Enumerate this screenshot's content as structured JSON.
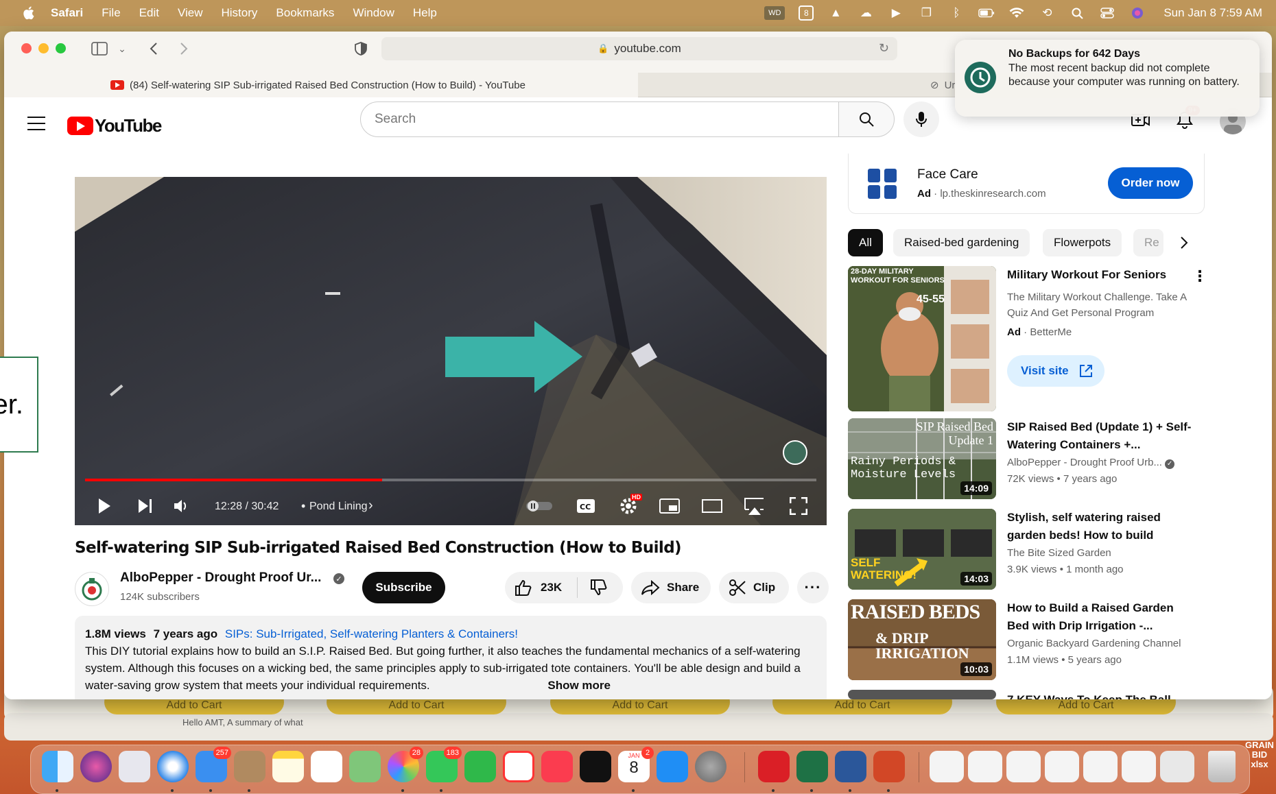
{
  "menubar": {
    "app": "Safari",
    "items": [
      "File",
      "Edit",
      "View",
      "History",
      "Bookmarks",
      "Window",
      "Help"
    ],
    "clock": "Sun Jan 8  7:59 AM"
  },
  "browser": {
    "url": "youtube.com",
    "active_tab": "(84) Self-watering SIP Sub-irrigated Raised Bed Construction (How to Build) - YouTube",
    "second_tab": "Ur"
  },
  "notification": {
    "title": "No Backups for 642 Days",
    "body": "The most recent backup did not complete because your computer was running on battery."
  },
  "youtube": {
    "logo": "YouTube",
    "search_placeholder": "Search",
    "notif_count": "9+"
  },
  "player": {
    "time": "12:28 / 30:42",
    "chapter": "Pond Lining",
    "progress": 0.406,
    "hd_badge": "HD"
  },
  "video": {
    "title": "Self-watering SIP Sub-irrigated Raised Bed Construction (How to Build)",
    "channel": "AlboPepper - Drought Proof Ur...",
    "subscribers": "124K subscribers",
    "subscribe_label": "Subscribe",
    "likes": "23K",
    "share_label": "Share",
    "clip_label": "Clip",
    "views": "1.8M views",
    "age": "7 years ago",
    "playlist": "SIPs: Sub-Irrigated, Self-watering Planters & Containers!",
    "description": "This DIY tutorial explains how to build an S.I.P. Raised Bed. But going further, it also teaches the fundamental mechanics of a self-watering system. Although this focuses on a wicking bed, the same principles apply to sub-irrigated tote containers. You'll be able design and build a water-saving grow system that meets your individual requirements.",
    "show_more": "Show more"
  },
  "ad": {
    "title": "Face Care",
    "label": "Ad",
    "domain": "lp.theskinresearch.com",
    "cta": "Order now"
  },
  "chips": [
    "All",
    "Raised-bed gardening",
    "Flowerpots",
    "Re"
  ],
  "recommendations": [
    {
      "title": "Military Workout For Seniors",
      "channel": "The Military Workout Challenge. Take A Quiz And Get Personal Program",
      "meta": "BetterMe",
      "ad_label": "Ad",
      "cta": "Visit site",
      "thumb_text": "28-DAY MILITARY WORKOUT FOR SENIORS",
      "thumb_num": "45-55"
    },
    {
      "title": "SIP Raised Bed (Update 1) + Self-Watering Containers +...",
      "channel": "AlboPepper - Drought Proof Urb...",
      "meta": "72K views  • 7 years ago",
      "duration": "14:09",
      "thumb_text": "SIP Raised Bed Update 1",
      "thumb_text2": "Rainy Periods & Moisture Levels"
    },
    {
      "title": "Stylish, self watering raised garden beds! How to build",
      "channel": "The Bite Sized Garden",
      "meta": "3.9K views  • 1 month ago",
      "duration": "14:03",
      "thumb_text": "SELF WATERING!"
    },
    {
      "title": "How to Build a Raised Garden Bed with Drip Irrigation -...",
      "channel": "Organic Backyard Gardening Channel",
      "meta": "1.1M views  • 5 years ago",
      "duration": "10:03",
      "thumb_text": "RAISED BEDS",
      "thumb_text2": "& DRIP IRRIGATION"
    },
    {
      "title": "7 KEY Ways To Keep The Ball..."
    }
  ],
  "background": {
    "add_to_cart": "Add to Cart",
    "snippet": "Hello AMT,  A summary of what"
  },
  "sidebox_text": "er.",
  "dock": {
    "mail_badge": "257",
    "photos_badge": "28",
    "messages_badge": "183",
    "calendar_month": "JAN",
    "calendar_day": "8",
    "calendar_badge": "2",
    "desktop_label": "GRAIN BID xlsx"
  },
  "colors": {
    "youtube_red": "#ff0000",
    "link_blue": "#065fd4",
    "menubar": "#be965a"
  }
}
